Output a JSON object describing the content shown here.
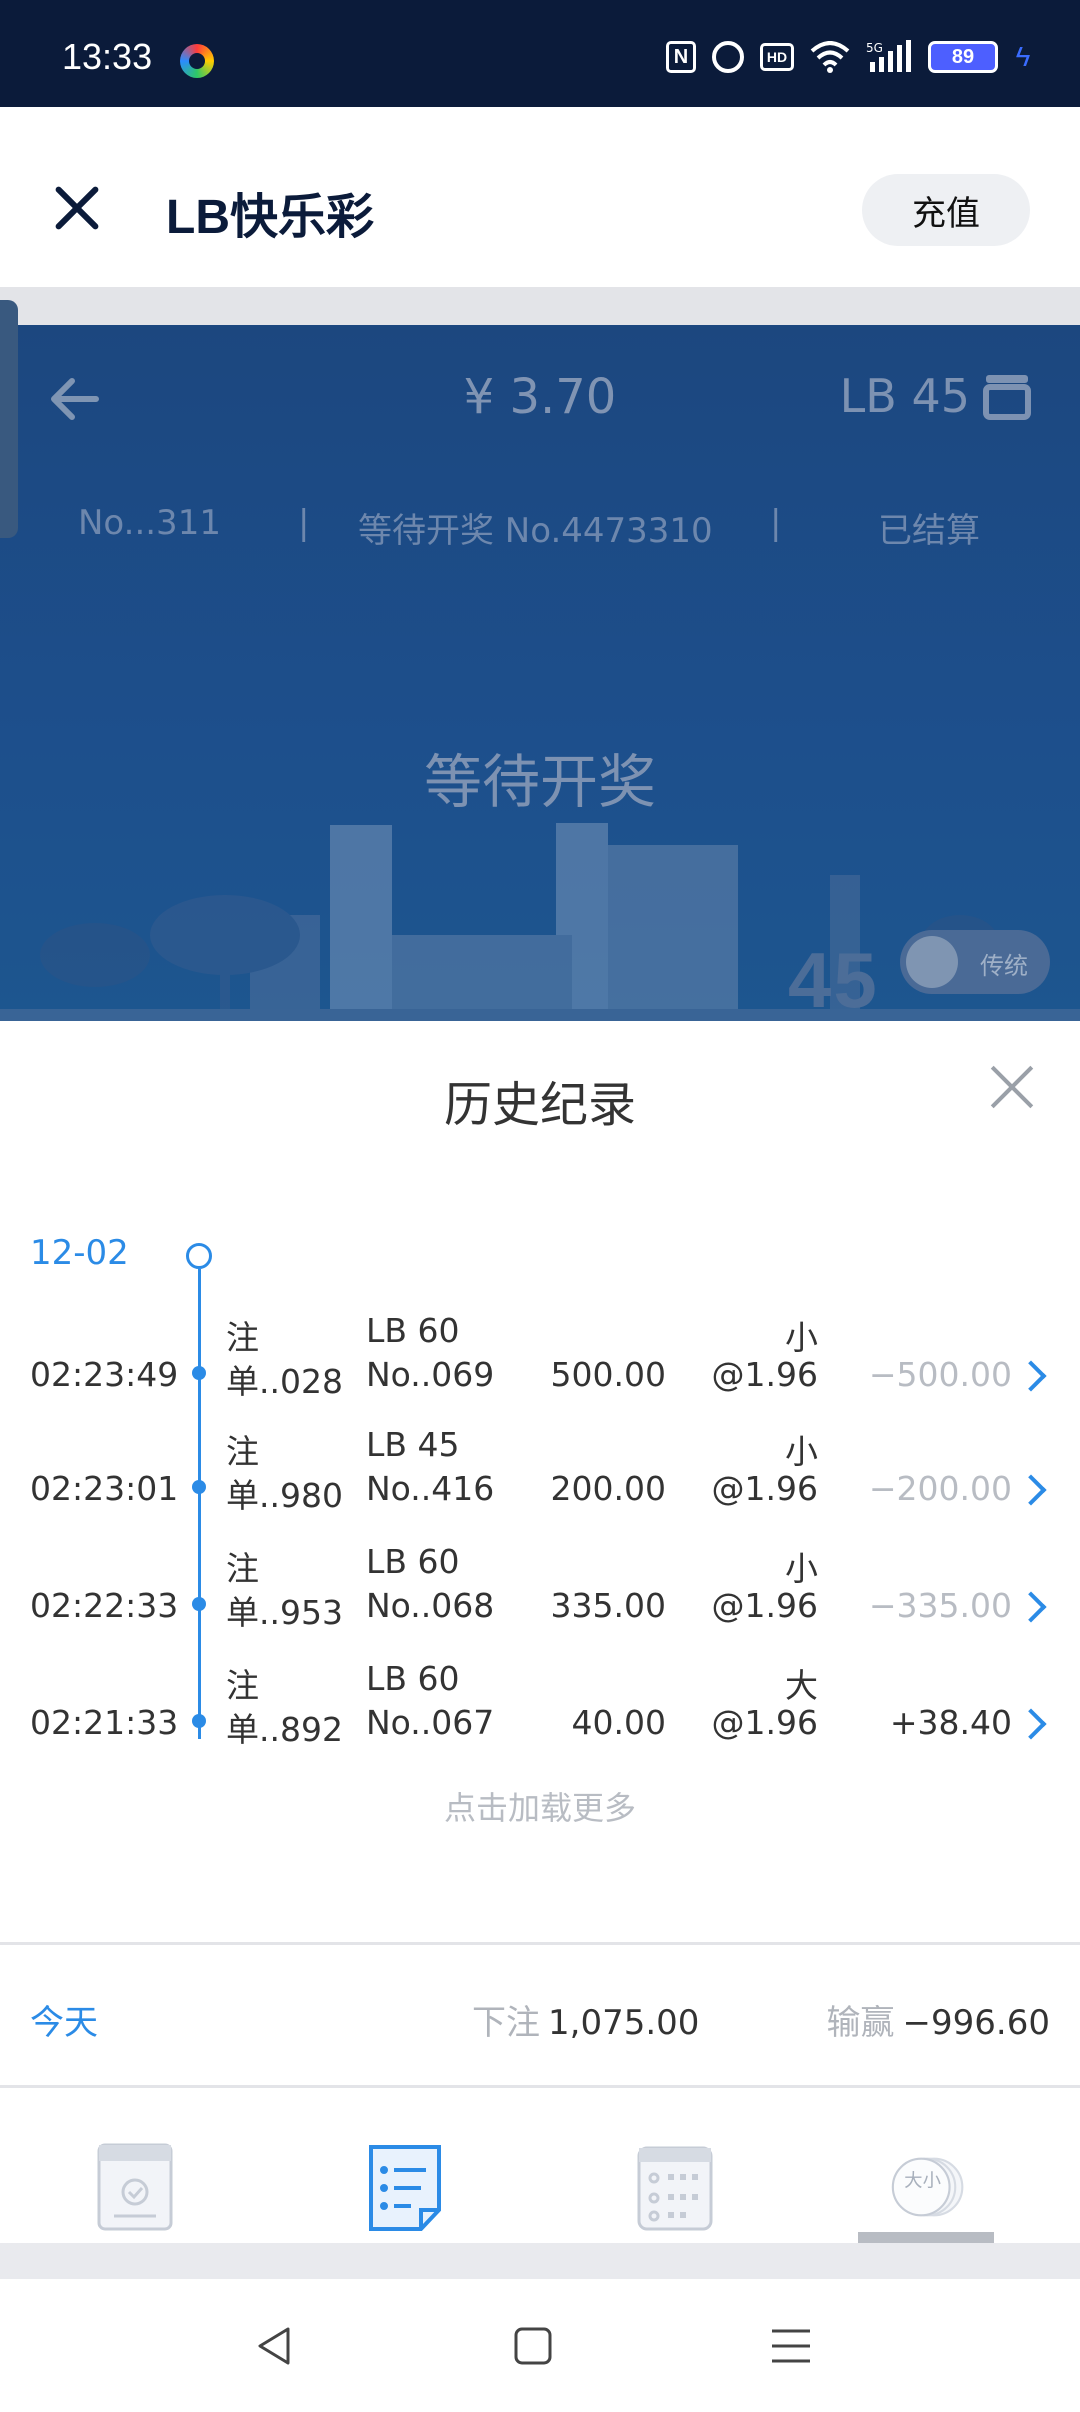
{
  "status_bar": {
    "time": "13:33",
    "battery": "89",
    "icons": [
      "nfc-icon",
      "alarm-icon",
      "hd-icon",
      "wifi-icon",
      "signal-5g-icon",
      "battery-icon",
      "charging-icon"
    ],
    "network": "5G"
  },
  "header": {
    "title": "LB快乐彩",
    "recharge_label": "充值"
  },
  "game": {
    "amount": "¥ 3.70",
    "lb_code": "LB 45",
    "order_no": "No...311",
    "separator": "|",
    "pending_round": "等待开奖 No.4473310",
    "settled_label": "已结算",
    "waiting_text": "等待开奖",
    "mode_toggle_label": "传统",
    "big_number": "45"
  },
  "history": {
    "title": "历史纪录",
    "date": "12-02",
    "records": [
      {
        "time": "02:23:49",
        "order_prefix": "注",
        "order": "单..028",
        "lb": "LB 60",
        "round": "No..069",
        "stake": "500.00",
        "pick": "小",
        "odds": "@1.96",
        "result": "−500.00",
        "status": "loss"
      },
      {
        "time": "02:23:01",
        "order_prefix": "注",
        "order": "单..980",
        "lb": "LB 45",
        "round": "No..416",
        "stake": "200.00",
        "pick": "小",
        "odds": "@1.96",
        "result": "−200.00",
        "status": "loss"
      },
      {
        "time": "02:22:33",
        "order_prefix": "注",
        "order": "单..953",
        "lb": "LB 60",
        "round": "No..068",
        "stake": "335.00",
        "pick": "小",
        "odds": "@1.96",
        "result": "−335.00",
        "status": "loss"
      },
      {
        "time": "02:21:33",
        "order_prefix": "注",
        "order": "单..892",
        "lb": "LB 60",
        "round": "No..067",
        "stake": "40.00",
        "pick": "大",
        "odds": "@1.96",
        "result": "+38.40",
        "status": "win"
      }
    ],
    "load_more": "点击加载更多"
  },
  "summary": {
    "period": "今天",
    "bet_label": "下注",
    "bet_value": "1,075.00",
    "win_label": "输赢",
    "win_value": "−996.60"
  },
  "tabs": [
    {
      "icon": "ticket-check-icon"
    },
    {
      "icon": "list-document-icon"
    },
    {
      "icon": "calendar-grid-icon"
    },
    {
      "icon": "big-small-coin-icon",
      "text": "大小"
    }
  ],
  "colors": {
    "accent": "#2b8be6",
    "status_bar": "#0b1b3a",
    "loss_text": "#b8bcc3"
  }
}
